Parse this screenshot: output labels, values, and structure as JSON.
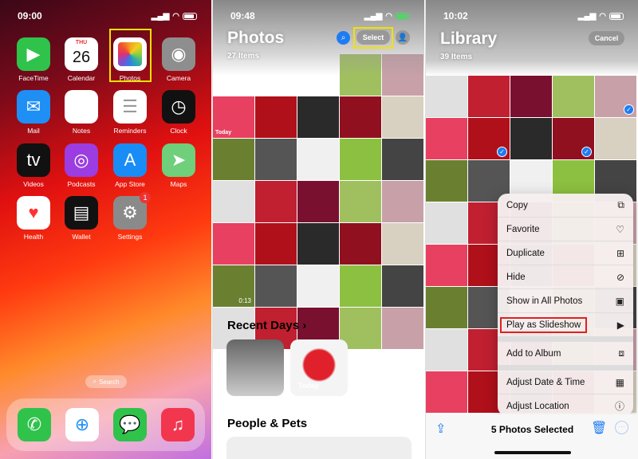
{
  "home": {
    "time": "09:00",
    "calendar_day": "THU",
    "calendar_date": "26",
    "settings_badge": "1",
    "search_label": "Search",
    "apps": [
      {
        "label": "FaceTime",
        "icon": "facetime-icon",
        "color": "#2fc34b"
      },
      {
        "label": "Calendar",
        "icon": "calendar-icon",
        "color": "#ffffff"
      },
      {
        "label": "Photos",
        "icon": "photos-icon",
        "color": "#ffffff"
      },
      {
        "label": "Camera",
        "icon": "camera-icon",
        "color": "#8e8e8e"
      },
      {
        "label": "Mail",
        "icon": "mail-icon",
        "color": "#1e8ff5"
      },
      {
        "label": "Notes",
        "icon": "notes-icon",
        "color": "#ffffff"
      },
      {
        "label": "Reminders",
        "icon": "reminders-icon",
        "color": "#ffffff"
      },
      {
        "label": "Clock",
        "icon": "clock-icon",
        "color": "#111111"
      },
      {
        "label": "Videos",
        "icon": "apple-tv-icon",
        "color": "#111111"
      },
      {
        "label": "Podcasts",
        "icon": "podcasts-icon",
        "color": "#9b3de0"
      },
      {
        "label": "App Store",
        "icon": "app-store-icon",
        "color": "#1a8cf5"
      },
      {
        "label": "Maps",
        "icon": "maps-icon",
        "color": "#6fcf7a"
      },
      {
        "label": "Health",
        "icon": "health-icon",
        "color": "#ffffff"
      },
      {
        "label": "Wallet",
        "icon": "wallet-icon",
        "color": "#111111"
      },
      {
        "label": "Settings",
        "icon": "settings-icon",
        "color": "#8a8a8a"
      }
    ],
    "dock": [
      {
        "icon": "phone-icon",
        "color": "#2fc34b"
      },
      {
        "icon": "safari-icon",
        "color": "#ffffff"
      },
      {
        "icon": "messages-icon",
        "color": "#2fc34b"
      },
      {
        "icon": "music-icon",
        "color": "#f2364e"
      }
    ]
  },
  "photos": {
    "time": "09:48",
    "title": "Photos",
    "count": "27 Items",
    "select_label": "Select",
    "video_duration": "0:13",
    "today_label": "Today",
    "recent_days": "Recent Days",
    "recent_today": "Today",
    "people_pets": "People & Pets"
  },
  "library": {
    "time": "10:02",
    "title": "Library",
    "count": "39 Items",
    "cancel_label": "Cancel",
    "selected_text": "5 Photos Selected",
    "menu": [
      {
        "label": "Copy",
        "icon": "copy-icon",
        "glyph": "⧉"
      },
      {
        "label": "Favorite",
        "icon": "heart-icon",
        "glyph": "♡"
      },
      {
        "label": "Duplicate",
        "icon": "duplicate-icon",
        "glyph": "⊞"
      },
      {
        "label": "Hide",
        "icon": "eye-slash-icon",
        "glyph": "⊘"
      },
      {
        "label": "Show in All Photos",
        "icon": "photos-stack-icon",
        "glyph": "▣"
      },
      {
        "label": "Play as Slideshow",
        "icon": "play-icon",
        "glyph": "▶"
      },
      {
        "label": "Add to Album",
        "icon": "add-album-icon",
        "glyph": "⧈"
      },
      {
        "label": "Adjust Date & Time",
        "icon": "calendar-clock-icon",
        "glyph": "▦"
      },
      {
        "label": "Adjust Location",
        "icon": "location-icon",
        "glyph": "ⓘ"
      }
    ]
  }
}
